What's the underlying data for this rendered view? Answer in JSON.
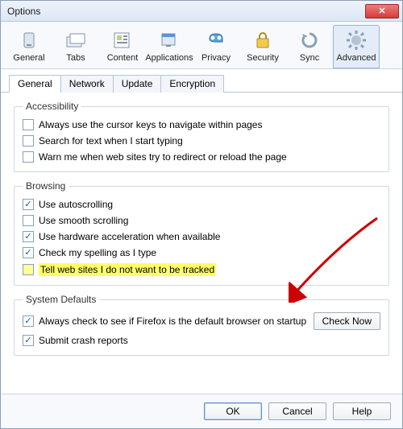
{
  "window": {
    "title": "Options"
  },
  "toolbar": {
    "items": [
      {
        "label": "General",
        "icon": "general-icon"
      },
      {
        "label": "Tabs",
        "icon": "tabs-icon"
      },
      {
        "label": "Content",
        "icon": "content-icon"
      },
      {
        "label": "Applications",
        "icon": "applications-icon"
      },
      {
        "label": "Privacy",
        "icon": "privacy-icon"
      },
      {
        "label": "Security",
        "icon": "security-icon"
      },
      {
        "label": "Sync",
        "icon": "sync-icon"
      },
      {
        "label": "Advanced",
        "icon": "advanced-icon"
      }
    ],
    "selected_index": 7
  },
  "subtabs": {
    "items": [
      "General",
      "Network",
      "Update",
      "Encryption"
    ],
    "active_index": 0
  },
  "groups": {
    "accessibility": {
      "legend": "Accessibility",
      "items": [
        {
          "label": "Always use the cursor keys to navigate within pages",
          "checked": false
        },
        {
          "label": "Search for text when I start typing",
          "checked": false
        },
        {
          "label": "Warn me when web sites try to redirect or reload the page",
          "checked": false
        }
      ]
    },
    "browsing": {
      "legend": "Browsing",
      "items": [
        {
          "label": "Use autoscrolling",
          "checked": true
        },
        {
          "label": "Use smooth scrolling",
          "checked": false
        },
        {
          "label": "Use hardware acceleration when available",
          "checked": true
        },
        {
          "label": "Check my spelling as I type",
          "checked": true
        },
        {
          "label": "Tell web sites I do not want to be tracked",
          "checked": false,
          "highlighted": true
        }
      ]
    },
    "system": {
      "legend": "System Defaults",
      "items": [
        {
          "label": "Always check to see if Firefox is the default browser on startup",
          "checked": true,
          "button": "Check Now"
        },
        {
          "label": "Submit crash reports",
          "checked": true
        }
      ]
    }
  },
  "footer": {
    "ok": "OK",
    "cancel": "Cancel",
    "help": "Help"
  }
}
